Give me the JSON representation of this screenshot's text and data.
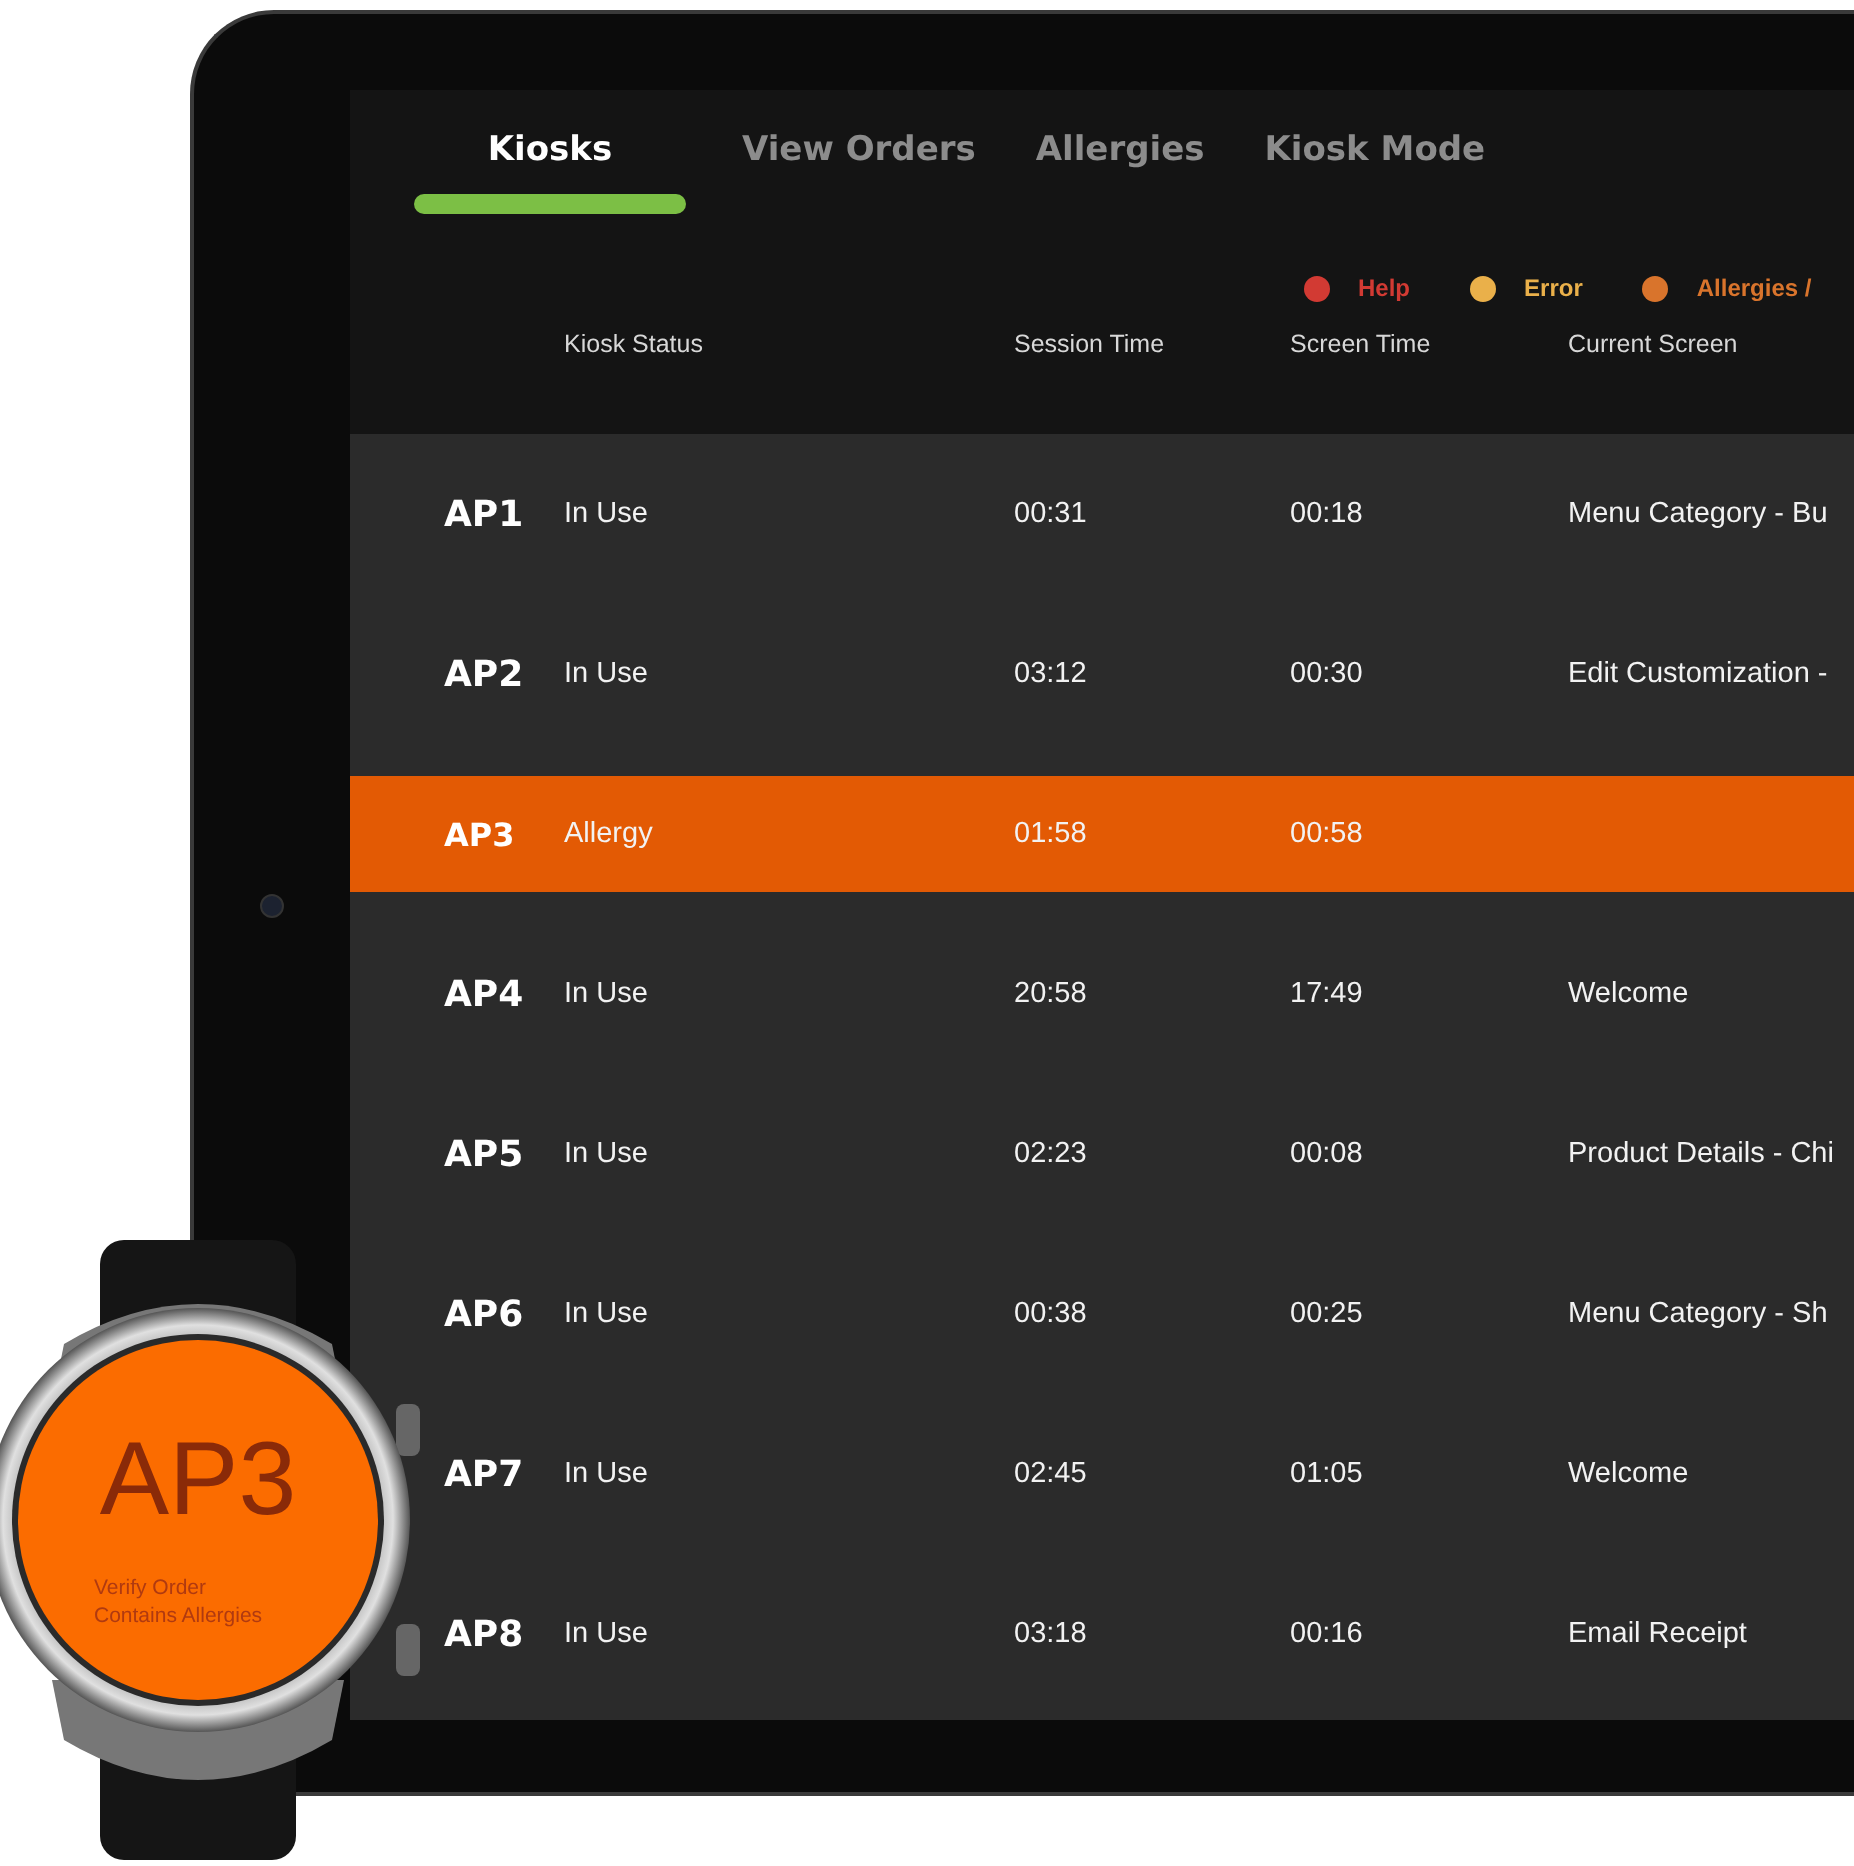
{
  "tabs": [
    {
      "label": "Kiosks",
      "selected": true
    },
    {
      "label": "View Orders",
      "selected": false
    },
    {
      "label": "Allergies",
      "selected": false
    },
    {
      "label": "Kiosk Mode",
      "selected": false
    }
  ],
  "legend": [
    {
      "label": "Help",
      "color": "#d23a33"
    },
    {
      "label": "Error",
      "color": "#eab04a"
    },
    {
      "label": "Allergies /",
      "color": "#d9742c"
    }
  ],
  "table": {
    "columns": [
      "Kiosk Status",
      "Session Time",
      "Screen Time",
      "Current Screen"
    ],
    "rows": [
      {
        "id": "AP1",
        "status": "In Use",
        "session_time": "00:31",
        "screen_time": "00:18",
        "current_screen": "Menu Category - Bu",
        "selected": false
      },
      {
        "id": "AP2",
        "status": "In Use",
        "session_time": "03:12",
        "screen_time": "00:30",
        "current_screen": "Edit Customization -",
        "selected": false
      },
      {
        "id": "AP3",
        "status": "Allergy",
        "session_time": "01:58",
        "screen_time": "00:58",
        "selected": true
      },
      {
        "id": "AP4",
        "status": "In Use",
        "session_time": "20:58",
        "screen_time": "17:49",
        "current_screen": "Welcome",
        "selected": false
      },
      {
        "id": "AP5",
        "status": "In Use",
        "session_time": "02:23",
        "screen_time": "00:08",
        "current_screen": "Product Details - Chi",
        "selected": false
      },
      {
        "id": "AP6",
        "status": "In Use",
        "session_time": "00:38",
        "screen_time": "00:25",
        "current_screen": "Menu Category - Sh",
        "selected": false
      },
      {
        "id": "AP7",
        "status": "In Use",
        "session_time": "02:45",
        "screen_time": "01:05",
        "current_screen": "Welcome",
        "selected": false
      },
      {
        "id": "AP8",
        "status": "In Use",
        "session_time": "03:18",
        "screen_time": "00:16",
        "current_screen": "Email Receipt",
        "selected": false
      }
    ]
  },
  "watch": {
    "title": "AP3",
    "message_lines": [
      "Verify Order",
      "Contains Allergies"
    ]
  }
}
